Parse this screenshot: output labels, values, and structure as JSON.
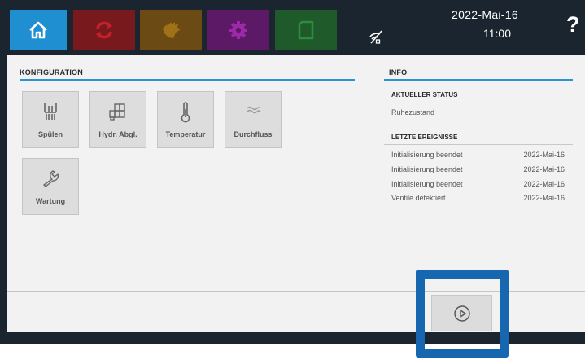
{
  "header": {
    "tabs": [
      {
        "name": "Home",
        "icon": "home-icon",
        "color": "#1f8fd2",
        "active": true
      },
      {
        "name": "Regelung",
        "icon": "cycle-arrows-icon",
        "color": "#78191e",
        "active": false
      },
      {
        "name": "Hand",
        "icon": "hand-icon",
        "color": "#6b4a14",
        "active": false
      },
      {
        "name": "Einstellungen",
        "icon": "gear-icon",
        "color": "#5c1a66",
        "active": false
      },
      {
        "name": "Protokoll",
        "icon": "document-icon",
        "color": "#1e5a2a",
        "active": false
      }
    ],
    "connection_icon": "no-connection-icon",
    "date": "2022-Mai-16",
    "time": "11:00",
    "help": "?"
  },
  "config": {
    "title": "KONFIGURATION",
    "tiles": [
      {
        "label": "Spülen",
        "icon": "flush-icon"
      },
      {
        "label": "Hydr. Abgl.",
        "icon": "valves-icon"
      },
      {
        "label": "Temperatur",
        "icon": "thermometer-icon"
      },
      {
        "label": "Durchfluss",
        "icon": "flow-waves-icon"
      },
      {
        "label": "Wartung",
        "icon": "wrench-icon"
      }
    ]
  },
  "info": {
    "title": "INFO",
    "status_title": "AKTUELLER STATUS",
    "status_value": "Ruhezustand",
    "events_title": "LETZTE EREIGNISSE",
    "events": [
      {
        "text": "Initialisierung beendet",
        "date": "2022-Mai-16"
      },
      {
        "text": "Initialisierung beendet",
        "date": "2022-Mai-16"
      },
      {
        "text": "Initialisierung beendet",
        "date": "2022-Mai-16"
      },
      {
        "text": "Ventile detektiert",
        "date": "2022-Mai-16"
      }
    ]
  },
  "footer": {
    "play_icon": "play-circle-icon",
    "highlight_color": "#1667b0"
  }
}
